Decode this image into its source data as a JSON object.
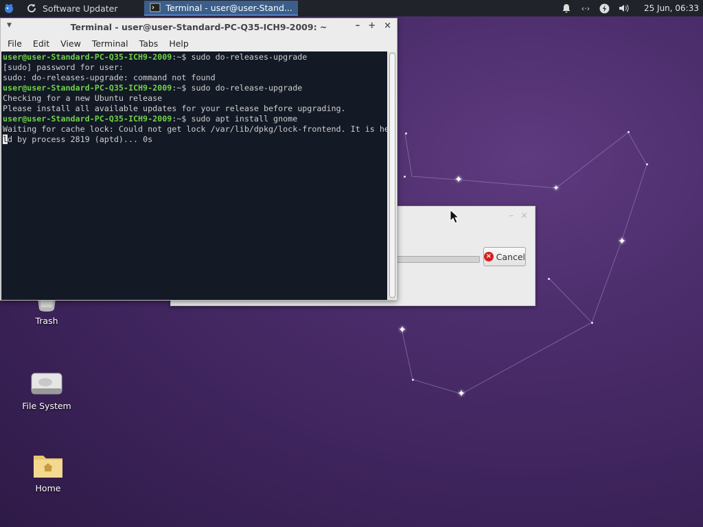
{
  "panel": {
    "menu_icon": "xfce-mouse-icon",
    "tasks": [
      {
        "label": "Software Updater",
        "icon": "refresh-icon",
        "active": false
      },
      {
        "label": "Terminal - user@user-Stand...",
        "icon": "terminal-icon",
        "active": true
      }
    ],
    "tray_icons": [
      "bell-icon",
      "network-icon",
      "power-icon",
      "volume-icon"
    ],
    "clock": "25 Jun, 06:33"
  },
  "terminal": {
    "title": "Terminal - user@user-Standard-PC-Q35-ICH9-2009: ~",
    "menu": [
      "File",
      "Edit",
      "View",
      "Terminal",
      "Tabs",
      "Help"
    ],
    "prompt_user": "user@user-Standard-PC-Q35-ICH9-2009",
    "prompt_suffix": ":~$ ",
    "lines": [
      {
        "type": "prompt",
        "cmd": "sudo do-releases-upgrade"
      },
      {
        "type": "out",
        "text": "[sudo] password for user:"
      },
      {
        "type": "out",
        "text": "sudo: do-releases-upgrade: command not found"
      },
      {
        "type": "prompt",
        "cmd": "sudo do-release-upgrade"
      },
      {
        "type": "out",
        "text": "Checking for a new Ubuntu release"
      },
      {
        "type": "out",
        "text": "Please install all available updates for your release before upgrading."
      },
      {
        "type": "prompt",
        "cmd": "sudo apt install gnome"
      },
      {
        "type": "out",
        "text": "Waiting for cache lock: Could not get lock /var/lib/dpkg/lock-frontend. It is he"
      },
      {
        "type": "cursorline",
        "cursor_char": "l",
        "text": "d by process 2819 (aptd)... 0s"
      }
    ]
  },
  "dialog": {
    "cancel_label": "Cancel",
    "progress": 0.0
  },
  "desktop": {
    "icons": [
      {
        "label": "Trash",
        "icon": "trash-icon"
      },
      {
        "label": "File System",
        "icon": "drive-icon"
      },
      {
        "label": "Home",
        "icon": "home-folder-icon"
      }
    ]
  },
  "colors": {
    "panel_bg": "#21232b",
    "terminal_bg": "#131925",
    "prompt_green": "#6fd24a",
    "desktop_purple": "#4a2c6a"
  }
}
